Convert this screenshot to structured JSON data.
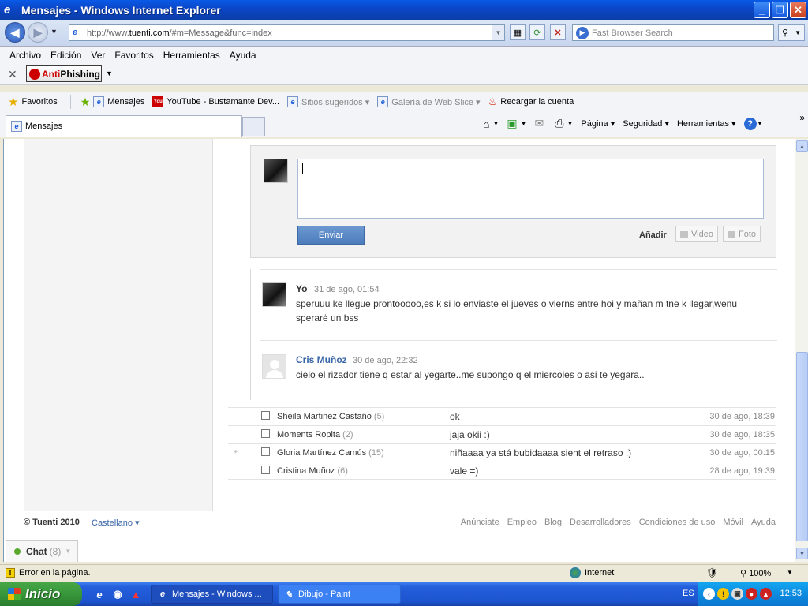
{
  "window": {
    "title": "Mensajes - Windows Internet Explorer",
    "minimize": "_",
    "restore": "❐",
    "close": "✕"
  },
  "address_bar": {
    "url_prefix": "http://www.",
    "url_domain": "tuenti.com",
    "url_path": "/#m=Message&func=index",
    "search_placeholder": "Fast Browser Search"
  },
  "menu": [
    "Archivo",
    "Edición",
    "Ver",
    "Favoritos",
    "Herramientas",
    "Ayuda"
  ],
  "antiphishing": {
    "prefix": "Anti",
    "suffix": "Phishing"
  },
  "favorites_bar": {
    "favorites_label": "Favoritos",
    "items": [
      {
        "label": "Mensajes",
        "icon": "ie-page-icon",
        "muted": false
      },
      {
        "label": "YouTube - Bustamante Dev...",
        "icon": "youtube-icon",
        "muted": false
      },
      {
        "label": "Sitios sugeridos ▾",
        "icon": "ie-page-icon",
        "muted": true
      },
      {
        "label": "Galería de Web Slice ▾",
        "icon": "ie-page-icon",
        "muted": true
      },
      {
        "label": "Recargar la cuenta",
        "icon": "flame-icon",
        "muted": false
      }
    ]
  },
  "tabs": {
    "active_label": "Mensajes"
  },
  "command_bar": {
    "page": "Página ▾",
    "security": "Seguridad ▾",
    "tools": "Herramientas ▾",
    "help_dd": "▾",
    "more": "»"
  },
  "composer": {
    "send_label": "Enviar",
    "add_label": "Añadir",
    "video_label": "Video",
    "photo_label": "Foto"
  },
  "thread": [
    {
      "author": "Yo",
      "time": "31 de ago, 01:54",
      "text": "speruuu ke llegue prontooooo,es k si lo enviaste el jueves o vierns entre hoi y mañan m tne k llegar,wenu sperarė un bss"
    },
    {
      "author": "Cris Muñoz",
      "time": "30 de ago, 22:32",
      "text": "cielo el rizador tiene q estar al yegarte..me supongo q el miercoles o asi te yegara.."
    }
  ],
  "conversations": [
    {
      "name": "Sheila Martinez Castaño",
      "count": "(5)",
      "snippet": "ok",
      "date": "30 de ago, 18:39",
      "replied": false
    },
    {
      "name": "Moments Ropita",
      "count": "(2)",
      "snippet": "jaja okii :)",
      "date": "30 de ago, 18:35",
      "replied": false
    },
    {
      "name": "Gloria Martínez Camús",
      "count": "(15)",
      "snippet": "niñaaaa ya stá bubidaaaa sient el retraso :)",
      "date": "30 de ago, 00:15",
      "replied": true
    },
    {
      "name": "Cristina Muñoz",
      "count": "(6)",
      "snippet": "vale =)",
      "date": "28 de ago, 19:39",
      "replied": false
    }
  ],
  "footer": {
    "copyright": "© Tuenti 2010",
    "language": "Castellano ▾",
    "links": [
      "Anúnciate",
      "Empleo",
      "Blog",
      "Desarrolladores",
      "Condiciones de uso",
      "Móvil",
      "Ayuda"
    ]
  },
  "chat": {
    "label": "Chat",
    "count": "(8)"
  },
  "status_bar": {
    "error_text": "Error en la página.",
    "zone": "Internet",
    "zoom": "100%"
  },
  "taskbar": {
    "start_label": "Inicio",
    "tasks": [
      {
        "label": "Mensajes - Windows ...",
        "active": true
      },
      {
        "label": "Dibujo - Paint",
        "active": false
      }
    ],
    "language": "ES",
    "clock": "12:53"
  }
}
